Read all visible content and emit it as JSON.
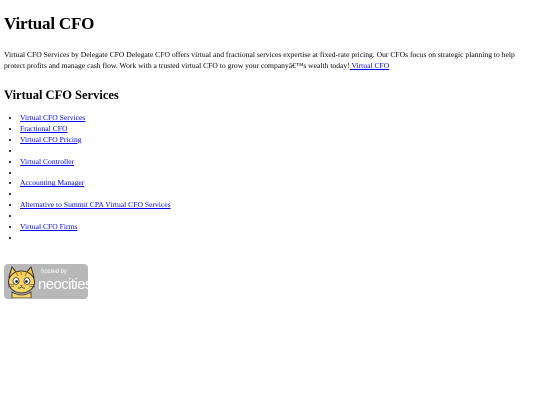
{
  "page": {
    "title": "Virtual CFO",
    "intro": {
      "text": "Virtual CFO Services by Delegate CFO Delegate CFO offers virtual and fractional services expertise at fixed-rate pricing. Our CFOs focus on strategic planning to help protect profits and manage cash flow. Work with a trusted virtual CFO to grow your companyâ€™s wealth today!",
      "link_label": " Virtual CFO"
    },
    "section_heading": "Virtual CFO Services",
    "services": [
      "Virtual CFO Services",
      "Fractional CFO",
      "Virtual CFO Pricing",
      "",
      "Virtual Controller",
      "",
      "Accounting Manager",
      "",
      "Alternative to Summit CPA Virtual CFO Services",
      "",
      "Virtual CFO Firms",
      ""
    ]
  },
  "badge": {
    "hosted_label": "hosted by",
    "brand": "neocities",
    "icon": "neocities-cat-icon"
  },
  "colors": {
    "link": "#0000ee",
    "badge_bg": "#b8b8b8"
  }
}
